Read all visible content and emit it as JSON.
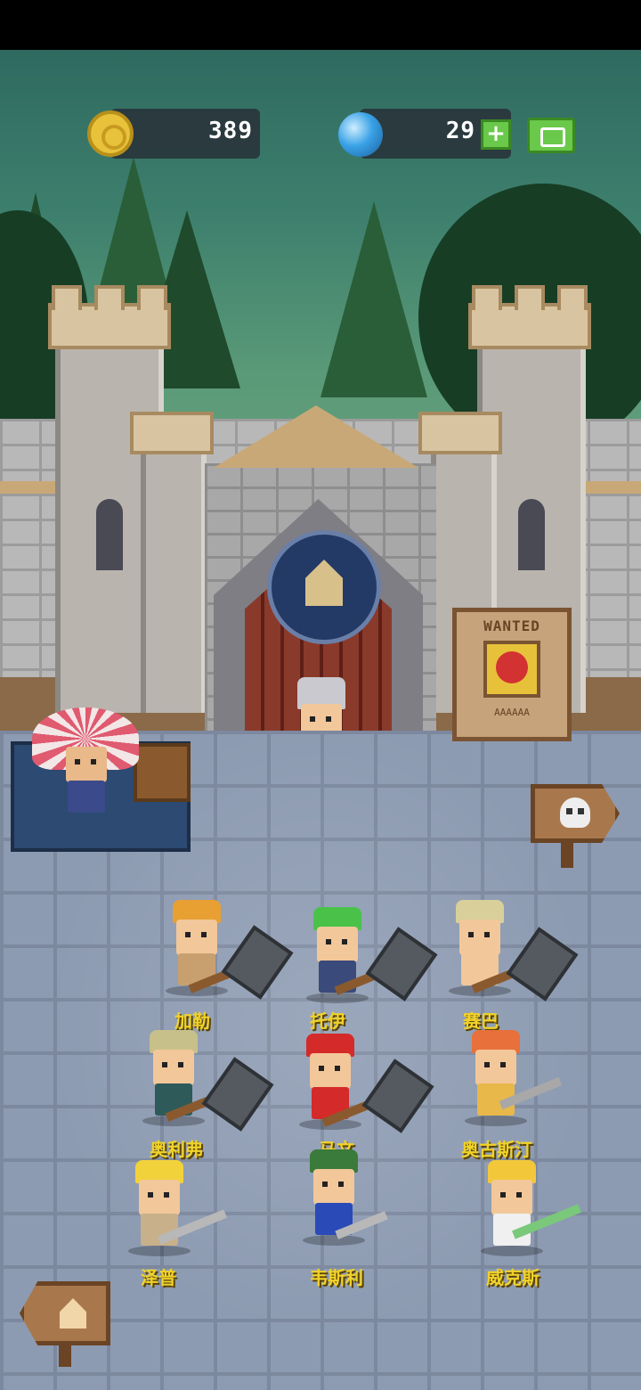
{
  "hud": {
    "gold": "389",
    "gems": "29",
    "add_gems_label": "+"
  },
  "wanted_sign": {
    "title": "WANTED",
    "subtitle": "AAAAAA"
  },
  "heroes": [
    {
      "name": "加勒"
    },
    {
      "name": "托伊"
    },
    {
      "name": "赛巴"
    },
    {
      "name": "奥利弗"
    },
    {
      "name": "马文"
    },
    {
      "name": "奥古斯汀"
    },
    {
      "name": "泽普"
    },
    {
      "name": "韦斯利"
    },
    {
      "name": "威克斯"
    }
  ],
  "colors": {
    "gold": "#e8c23a",
    "gem": "#3aa2e6",
    "button_green": "#6ac84a",
    "hero_name": "#f0d22a"
  },
  "icons": {
    "gold": "coin-icon",
    "gem": "gem-icon",
    "add": "plus-icon",
    "share": "share-icon",
    "dungeon": "skull-icon",
    "home": "house-icon"
  }
}
